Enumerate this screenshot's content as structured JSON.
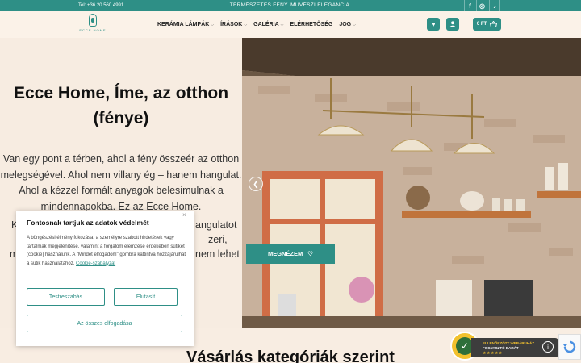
{
  "topbar": {
    "phone": "Tel: +36 20 560 4991",
    "slogan": "TERMÉSZETES FÉNY. MŰVÉSZI ELEGANCIA.",
    "social": [
      "f",
      "◎",
      "♪"
    ]
  },
  "header": {
    "logo_text": "ECCE HOME",
    "nav": [
      {
        "label": "KERÁMIA LÁMPÁK",
        "dropdown": true
      },
      {
        "label": "ÍRÁSOK",
        "dropdown": true
      },
      {
        "label": "GALÉRIA",
        "dropdown": true
      },
      {
        "label": "ELÉRHETŐSÉG",
        "dropdown": false
      },
      {
        "label": "JOG",
        "dropdown": true
      }
    ],
    "cart_label": "0 FT"
  },
  "hero": {
    "title": "Ecce Home, Íme, az otthon (fénye)",
    "text": "Van egy pont a térben, ahol a fény összeér az otthon melegségével. Ahol nem villany ég – hanem hangulat. Ahol a kézzel formált anyagok belesimulnak a mindennapokba. Ez az Ecce Home.",
    "hidden_lines": [
      {
        "left": "K",
        "right": "angulatot"
      },
      {
        "left": "",
        "right": "zeri,"
      },
      {
        "left": "m",
        "right": "nem lehet"
      }
    ],
    "cta_label": "MEGNÉZEM"
  },
  "section": {
    "heading": "Vásárlás kategóriák szerint"
  },
  "badge": {
    "line1": "ELLENŐRZÖTT WEBÁRUHÁZ",
    "line2": "FOGYASZTÓ BARÁT",
    "stars": "★★★★★"
  },
  "cookie": {
    "title": "Fontosnak tartjuk az adatok védelmét",
    "body": "A böngészési élmény fokozása, a személyre szabott hirdetések vagy tartalmak megjelenítése, valamint a forgalom elemzése érdekében sütiket (cookie) használunk. A \"Mindet elfogadom\" gombra kattintva hozzájárulhat a sütik használatához.",
    "link": "Cookie-szabályzat",
    "customize": "Testreszabás",
    "reject": "Elutasít",
    "accept_all": "Az összes elfogadása"
  },
  "colors": {
    "accent": "#2e8f86",
    "background": "#f8ede2"
  }
}
